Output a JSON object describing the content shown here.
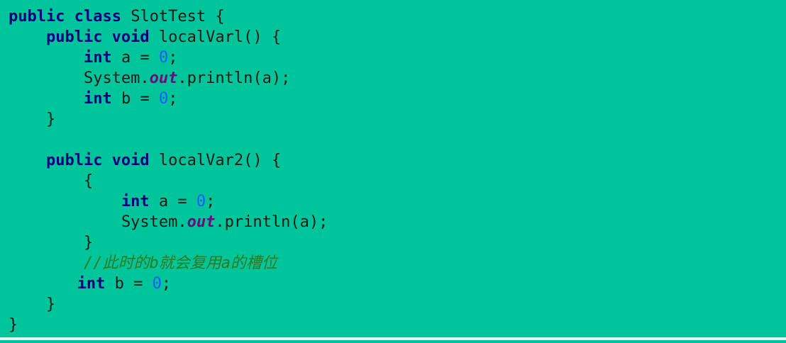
{
  "colors": {
    "background": "#00C49A",
    "keyword": "#000080",
    "text": "#1a1a1a",
    "number": "#1a5cff",
    "field": "#660E7A",
    "comment": "#2f7a1f"
  },
  "code": {
    "lines": [
      {
        "tokens": [
          {
            "type": "keyword",
            "text": "public class"
          },
          {
            "type": "text",
            "text": " SlotTest {"
          }
        ]
      },
      {
        "tokens": [
          {
            "type": "keyword",
            "text": "public void"
          },
          {
            "type": "text",
            "text": " localVarl() {"
          }
        ]
      },
      {
        "tokens": [
          {
            "type": "keyword",
            "text": "int"
          },
          {
            "type": "text",
            "text": " a = "
          },
          {
            "type": "number",
            "text": "0"
          },
          {
            "type": "text",
            "text": ";"
          }
        ]
      },
      {
        "tokens": [
          {
            "type": "text",
            "text": "System."
          },
          {
            "type": "field",
            "text": "out"
          },
          {
            "type": "text",
            "text": ".println(a);"
          }
        ]
      },
      {
        "tokens": [
          {
            "type": "keyword",
            "text": "int"
          },
          {
            "type": "text",
            "text": " b = "
          },
          {
            "type": "number",
            "text": "0"
          },
          {
            "type": "text",
            "text": ";"
          }
        ]
      },
      {
        "tokens": [
          {
            "type": "text",
            "text": "}"
          }
        ]
      },
      {
        "tokens": []
      },
      {
        "tokens": [
          {
            "type": "keyword",
            "text": "public void"
          },
          {
            "type": "text",
            "text": " localVar2() {"
          }
        ]
      },
      {
        "tokens": [
          {
            "type": "text",
            "text": "{"
          }
        ]
      },
      {
        "tokens": [
          {
            "type": "keyword",
            "text": "int"
          },
          {
            "type": "text",
            "text": " a = "
          },
          {
            "type": "number",
            "text": "0"
          },
          {
            "type": "text",
            "text": ";"
          }
        ]
      },
      {
        "tokens": [
          {
            "type": "text",
            "text": "System."
          },
          {
            "type": "field",
            "text": "out"
          },
          {
            "type": "text",
            "text": ".println(a);"
          }
        ]
      },
      {
        "tokens": [
          {
            "type": "text",
            "text": "}"
          }
        ]
      },
      {
        "tokens": [
          {
            "type": "comment",
            "text": "//此时的b就会复用a的槽位"
          }
        ]
      },
      {
        "tokens": [
          {
            "type": "keyword",
            "text": "int"
          },
          {
            "type": "text",
            "text": " b = "
          },
          {
            "type": "number",
            "text": "0"
          },
          {
            "type": "text",
            "text": ";"
          }
        ]
      },
      {
        "tokens": [
          {
            "type": "text",
            "text": "}"
          }
        ]
      },
      {
        "tokens": [
          {
            "type": "text",
            "text": "}"
          }
        ]
      }
    ]
  }
}
